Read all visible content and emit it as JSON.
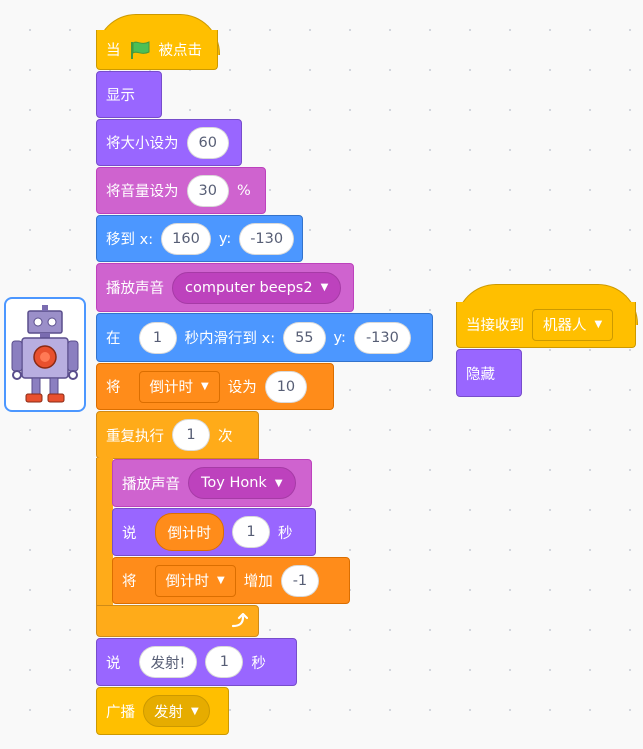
{
  "script_main": {
    "hat": {
      "prefix": "当",
      "flag_icon": "green-flag-icon",
      "suffix": "被点击"
    },
    "show": {
      "label": "显示"
    },
    "set_size": {
      "label": "将大小设为",
      "value": "60"
    },
    "set_volume": {
      "label": "将音量设为",
      "value": "30",
      "unit": "%"
    },
    "goto_xy": {
      "label": "移到 x:",
      "x": "160",
      "y_label": "y:",
      "y": "-130"
    },
    "play_sound": {
      "label": "播放声音",
      "sound": "computer beeps2"
    },
    "glide": {
      "prefix": "在",
      "secs": "1",
      "mid": "秒内滑行到 x:",
      "x": "55",
      "y_label": "y:",
      "y": "-130"
    },
    "set_var": {
      "prefix": "将",
      "var": "倒计时",
      "mid": "设为",
      "value": "10"
    },
    "repeat": {
      "label": "重复执行",
      "times": "1",
      "suffix": "次"
    },
    "inner_play_sound": {
      "label": "播放声音",
      "sound": "Toy Honk"
    },
    "inner_say": {
      "label": "说",
      "reporter": "倒计时",
      "secs": "1",
      "suffix": "秒"
    },
    "inner_change_var": {
      "prefix": "将",
      "var": "倒计时",
      "mid": "增加",
      "value": "-1"
    },
    "say_after": {
      "label": "说",
      "text": "发射!",
      "secs": "1",
      "suffix": "秒"
    },
    "broadcast": {
      "label": "广播",
      "message": "发射"
    }
  },
  "script_receive": {
    "hat": {
      "label": "当接收到",
      "message": "机器人"
    },
    "hide": {
      "label": "隐藏"
    }
  },
  "sprite": {
    "icon": "robot-sprite-icon"
  },
  "colors": {
    "events": "#ffbf00",
    "looks": "#9966ff",
    "sound": "#cf63cf",
    "motion": "#4c97ff",
    "variables": "#ff8c1a",
    "control": "#ffab19"
  }
}
